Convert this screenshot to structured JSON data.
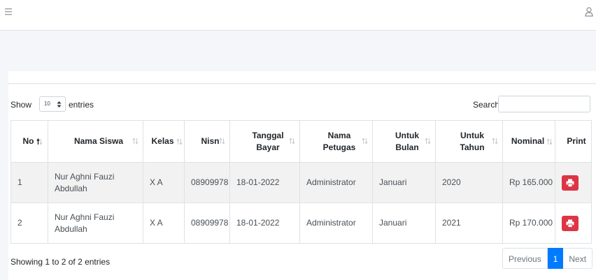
{
  "table": {
    "controls": {
      "show_label": "Show",
      "entries_label": "entries",
      "length_value": "10",
      "search_label": "Search:",
      "search_value": ""
    },
    "columns": [
      {
        "label": "No",
        "sort": "ascending"
      },
      {
        "label": "Nama Siswa",
        "sort": "none"
      },
      {
        "label": "Kelas",
        "sort": "none"
      },
      {
        "label": "Nisn",
        "sort": "none"
      },
      {
        "label": "Tanggal Bayar",
        "sort": "none"
      },
      {
        "label": "Nama Petugas",
        "sort": "none"
      },
      {
        "label": "Untuk Bulan",
        "sort": "none"
      },
      {
        "label": "Untuk Tahun",
        "sort": "none"
      },
      {
        "label": "Nominal",
        "sort": "none"
      },
      {
        "label": "Print",
        "sort": "disabled"
      }
    ],
    "rows": [
      {
        "no": "1",
        "nama_siswa": "Nur Aghni Fauzi Abdullah",
        "kelas": "X A",
        "nisn": "08909978",
        "tanggal_bayar": "18-01-2022",
        "nama_petugas": "Administrator",
        "untuk_bulan": "Januari",
        "untuk_tahun": "2020",
        "nominal": "Rp 165.000"
      },
      {
        "no": "2",
        "nama_siswa": "Nur Aghni Fauzi Abdullah",
        "kelas": "X A",
        "nisn": "08909978",
        "tanggal_bayar": "18-01-2022",
        "nama_petugas": "Administrator",
        "untuk_bulan": "Januari",
        "untuk_tahun": "2021",
        "nominal": "Rp 170.000"
      }
    ],
    "info": "Showing 1 to 2 of 2 entries",
    "pagination": {
      "previous": "Previous",
      "current": "1",
      "next": "Next"
    }
  },
  "icons": {
    "menu": "hamburger-icon",
    "user": "user-icon",
    "print": "print-icon"
  },
  "colors": {
    "print_button": "#dc3545",
    "active_page": "#007bff"
  }
}
